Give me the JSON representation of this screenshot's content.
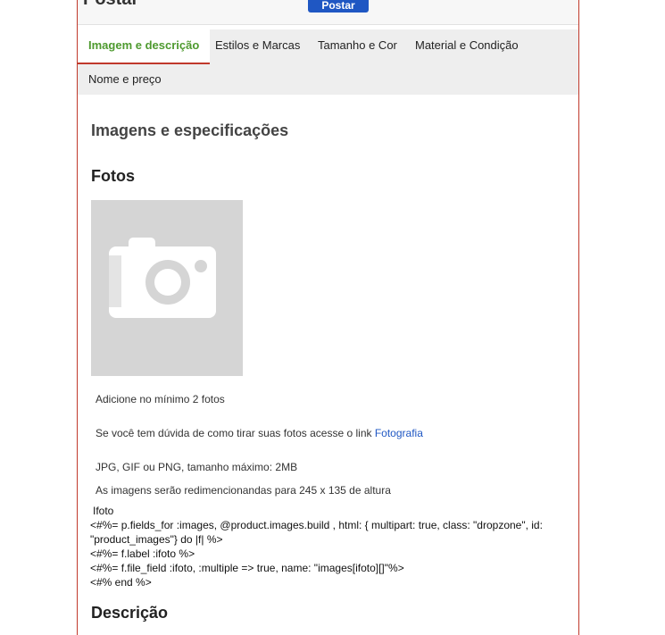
{
  "header": {
    "title": "Postar",
    "post_button": "Postar"
  },
  "tabs": [
    {
      "label": "Imagem e descrição",
      "active": true
    },
    {
      "label": "Estilos e Marcas",
      "active": false
    },
    {
      "label": "Tamanho e Cor",
      "active": false
    },
    {
      "label": "Material e Condição",
      "active": false
    },
    {
      "label": "Nome e preço",
      "active": false
    }
  ],
  "main": {
    "section_title": "Imagens e especificações",
    "photos_heading": "Fotos",
    "photo_placeholder_icon": "camera-icon",
    "min_photos": "Adicione no mínimo 2 fotos",
    "help_text": "Se você tem dúvida de como tirar suas fotos acesse o link",
    "help_link": "Fotografia",
    "formats": "JPG, GIF ou PNG, tamanho máximo: 2MB",
    "resize_note": "As imagens serão redimencionandas para 245 x 135 de altura",
    "code_lines": [
      "Ifoto",
      "<#%= p.fields_for :images, @product.images.build , html: { multipart: true, class: \"dropzone\", id: \"product_images\"} do |f| %>",
      "<#%= f.label :ifoto %>",
      "<#%= f.file_field :ifoto, :multiple => true, name: \"images[ifoto][]\"%>",
      "<#% end %>"
    ],
    "description_heading": "Descrição"
  },
  "colors": {
    "accent": "#1f57c3",
    "active_tab": "#4e9a2f",
    "border": "#c0392b"
  }
}
